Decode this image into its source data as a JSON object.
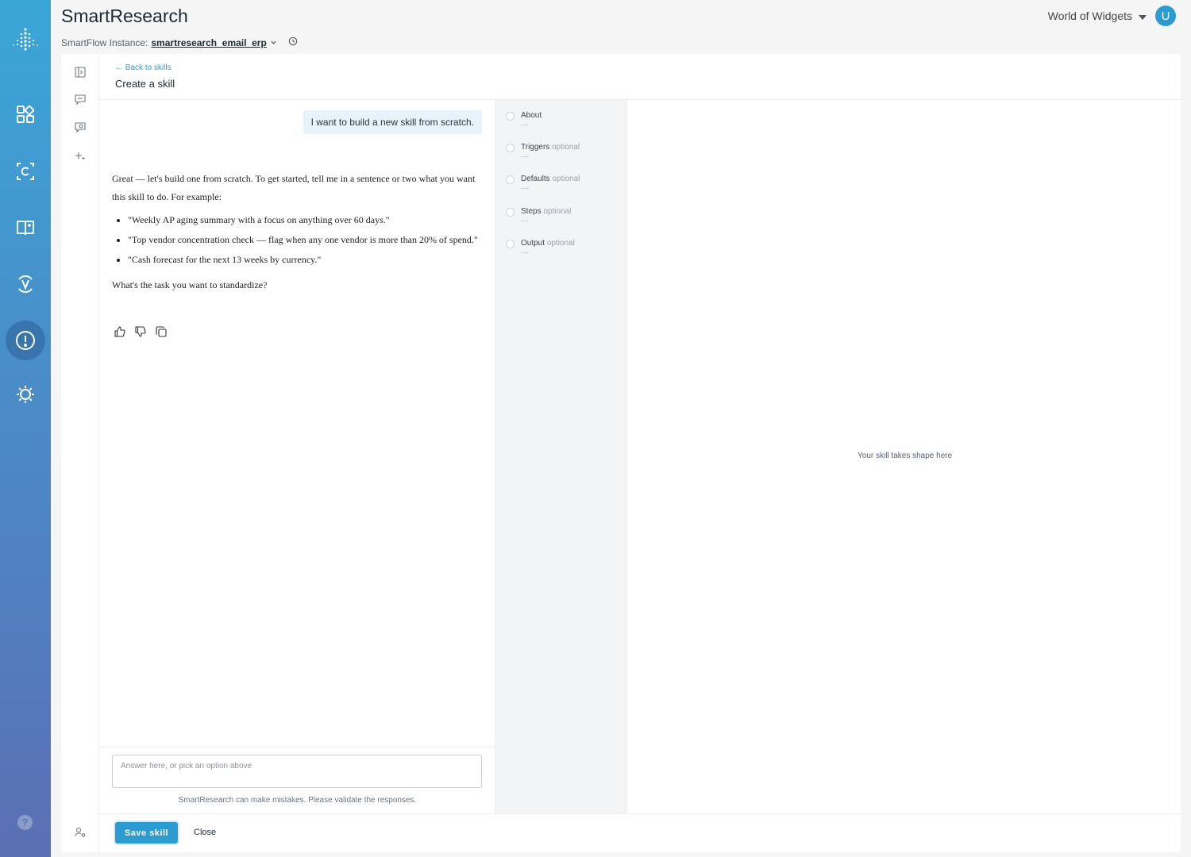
{
  "app": {
    "title": "SmartResearch"
  },
  "instance": {
    "label": "SmartFlow Instance:",
    "name": "smartresearch_email_erp"
  },
  "org": {
    "name": "World of Widgets"
  },
  "user": {
    "initial": "U"
  },
  "nav": {
    "items": [
      "dashboard-icon",
      "c-app-icon",
      "book-icon",
      "v-app-icon",
      "alert-circle-icon",
      "settings-icon"
    ],
    "active": "alert-circle-icon"
  },
  "header": {
    "back_label": "← Back to skills",
    "title": "Create a skill"
  },
  "chat": {
    "user_message": "I want to build a new skill from scratch.",
    "assistant_intro": "Great — let's build one from scratch. To get started, tell me in a sentence or two what you want this skill to do. For example:",
    "examples": [
      "\"Weekly AP aging summary with a focus on anything over 60 days.\"",
      "\"Top vendor concentration check — flag when any one vendor is more than 20% of spend.\"",
      "\"Cash forecast for the next 13 weeks by currency.\""
    ],
    "assistant_question": "What's the task you want to standardize?",
    "input_placeholder": "Answer here, or pick an option above",
    "disclaimer": "SmartResearch can make mistakes. Please validate the responses."
  },
  "steps": [
    {
      "label": "About",
      "optional": "",
      "value": "—"
    },
    {
      "label": "Triggers",
      "optional": "optional",
      "value": "—"
    },
    {
      "label": "Defaults",
      "optional": "optional",
      "value": "—"
    },
    {
      "label": "Steps",
      "optional": "optional",
      "value": "—"
    },
    {
      "label": "Output",
      "optional": "optional",
      "value": "—"
    }
  ],
  "preview": {
    "empty_text": "Your skill takes shape here"
  },
  "footer": {
    "save_label": "Save skill",
    "close_label": "Close"
  },
  "help": {
    "glyph": "?"
  },
  "colors": {
    "accent": "#2b9bd1",
    "rail_top": "#3aa6d8",
    "rail_bottom": "#5b6fb4"
  }
}
